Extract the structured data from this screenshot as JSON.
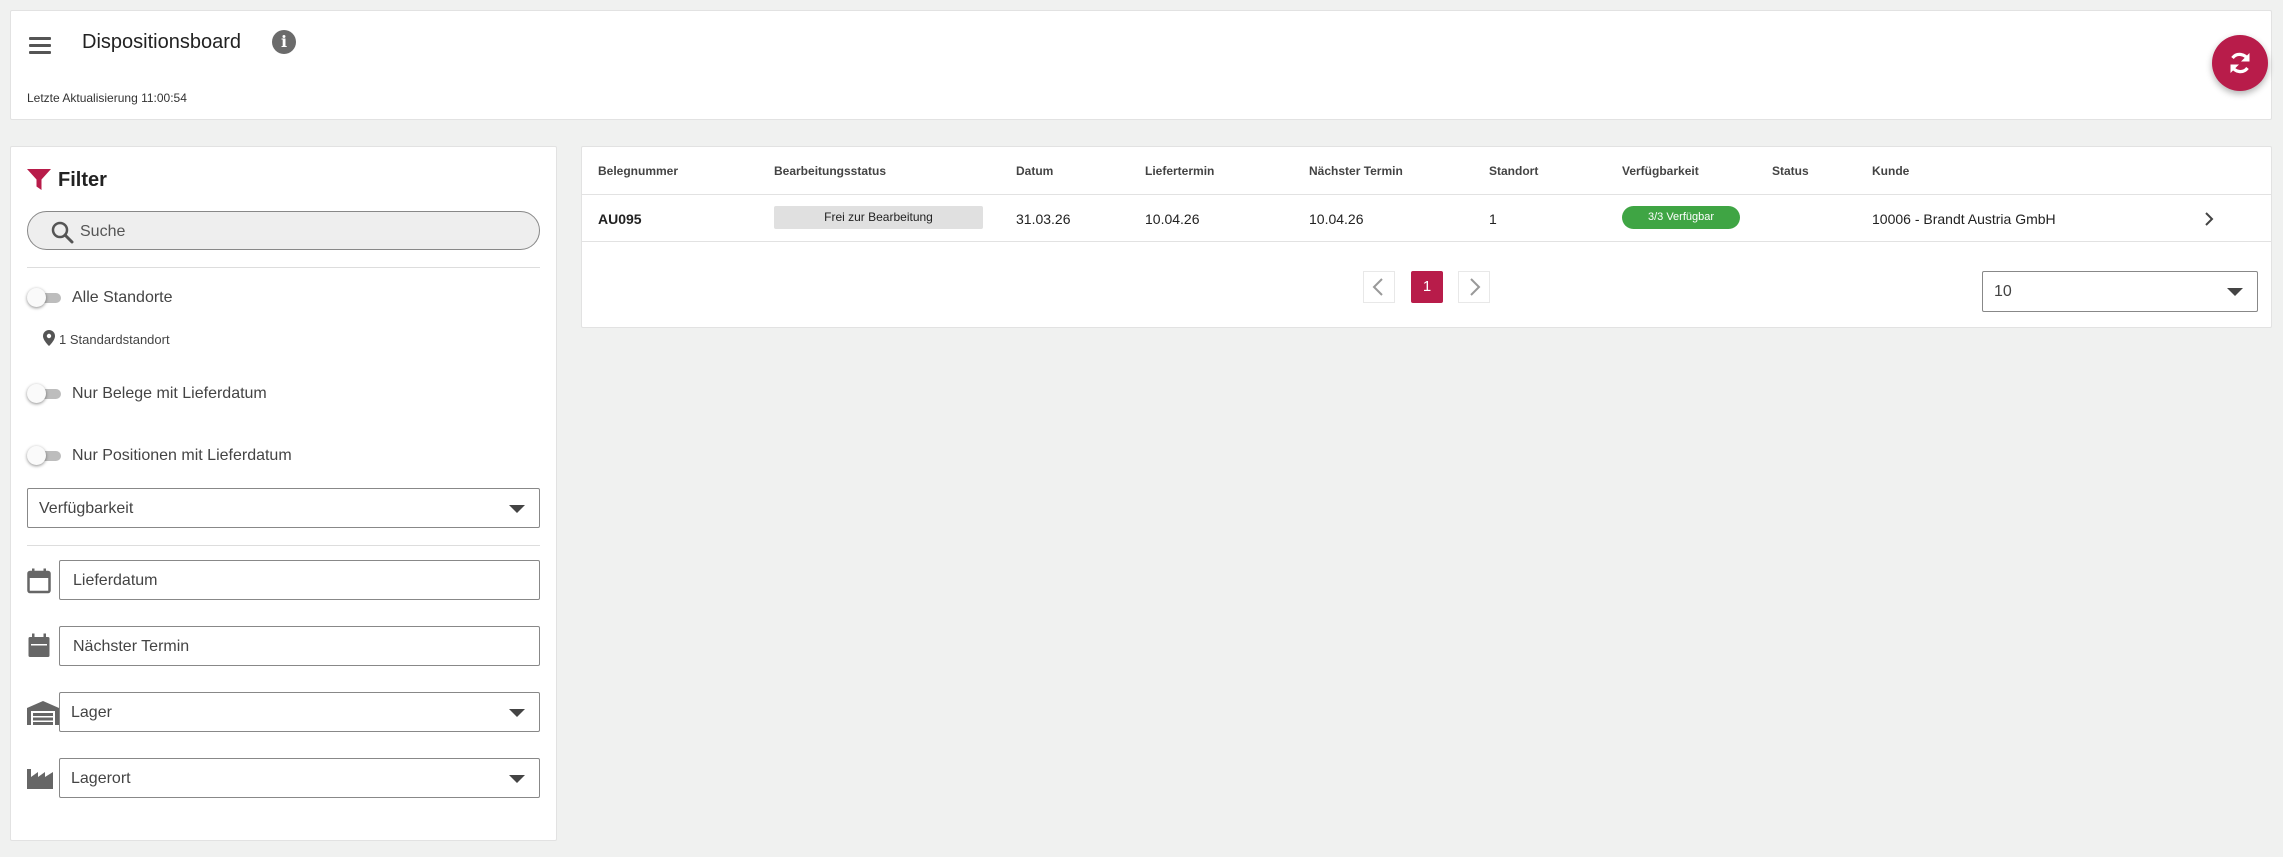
{
  "header": {
    "title": "Dispositionsboard",
    "last_update": "Letzte Aktualisierung 11:00:54",
    "accent_color": "#b81c4a"
  },
  "filter": {
    "title": "Filter",
    "search_placeholder": "Suche",
    "toggles": [
      {
        "label": "Alle Standorte",
        "checked": false
      },
      {
        "label": "Nur Belege mit Lieferdatum",
        "checked": false
      },
      {
        "label": "Nur Positionen mit Lieferdatum",
        "checked": false
      }
    ],
    "standort_info": "1 Standardstandort",
    "availability_select": "Verfügbarkeit",
    "lieferdatum_placeholder": "Lieferdatum",
    "naechster_termin_placeholder": "Nächster Termin",
    "lager_select": "Lager",
    "lagerort_select": "Lagerort"
  },
  "table": {
    "columns": [
      "Belegnummer",
      "Bearbeitungsstatus",
      "Datum",
      "Liefertermin",
      "Nächster Termin",
      "Standort",
      "Verfügbarkeit",
      "Status",
      "Kunde"
    ],
    "rows": [
      {
        "belegnummer": "AU095",
        "bearbeitungsstatus": "Frei zur Bearbeitung",
        "datum": "31.03.26",
        "liefertermin": "10.04.26",
        "naechster_termin": "10.04.26",
        "standort": "1",
        "verfuegbarkeit": "3/3 Verfügbar",
        "status": "",
        "kunde": "10006 - Brandt Austria GmbH"
      }
    ]
  },
  "pagination": {
    "current_page": "1",
    "page_size": "10"
  }
}
